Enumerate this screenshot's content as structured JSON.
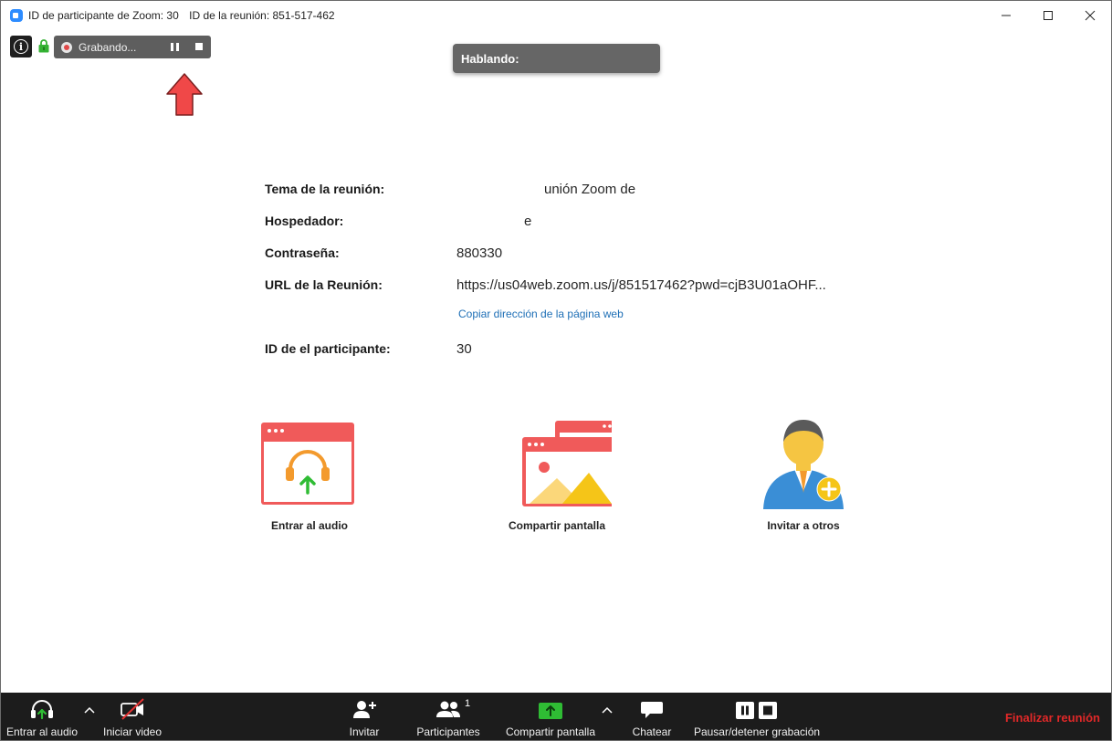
{
  "window": {
    "title_participant": "ID de participante de Zoom: 30",
    "title_meeting": "ID de la reunión: 851-517-462",
    "minimize": "—",
    "maximize": "☐",
    "close": "✕"
  },
  "overlay": {
    "info": "i",
    "recording_text": "Grabando...",
    "speaking_label": "Hablando:"
  },
  "meeting_info": {
    "topic_label": "Tema de la reunión:",
    "topic_value": "unión Zoom de",
    "host_label": "Hospedador:",
    "host_value": "e",
    "password_label": "Contraseña:",
    "password_value": "880330",
    "url_label": "URL de la Reunión:",
    "url_value": "https://us04web.zoom.us/j/851517462?pwd=cjB3U01aOHF...",
    "copy_link": "Copiar dirección de la página web",
    "participant_label": "ID de el participante:",
    "participant_value": "30"
  },
  "actions": [
    {
      "label": "Entrar al audio",
      "icon": "audio-headphones-icon"
    },
    {
      "label": "Compartir pantalla",
      "icon": "share-screen-icon"
    },
    {
      "label": "Invitar a otros",
      "icon": "invite-person-icon"
    }
  ],
  "toolbar": {
    "join_audio": "Entrar al audio",
    "start_video": "Iniciar video",
    "invite": "Invitar",
    "participants": "Participantes",
    "participants_count": "1",
    "share_screen": "Compartir pantalla",
    "chat": "Chatear",
    "pause_stop_recording": "Pausar/detener grabación",
    "end_meeting": "Finalizar reunión"
  },
  "colors": {
    "accent_red": "#f05a5a",
    "share_green": "#2fbc34",
    "link_blue": "#1e6fb6",
    "end_red": "#e02828"
  }
}
